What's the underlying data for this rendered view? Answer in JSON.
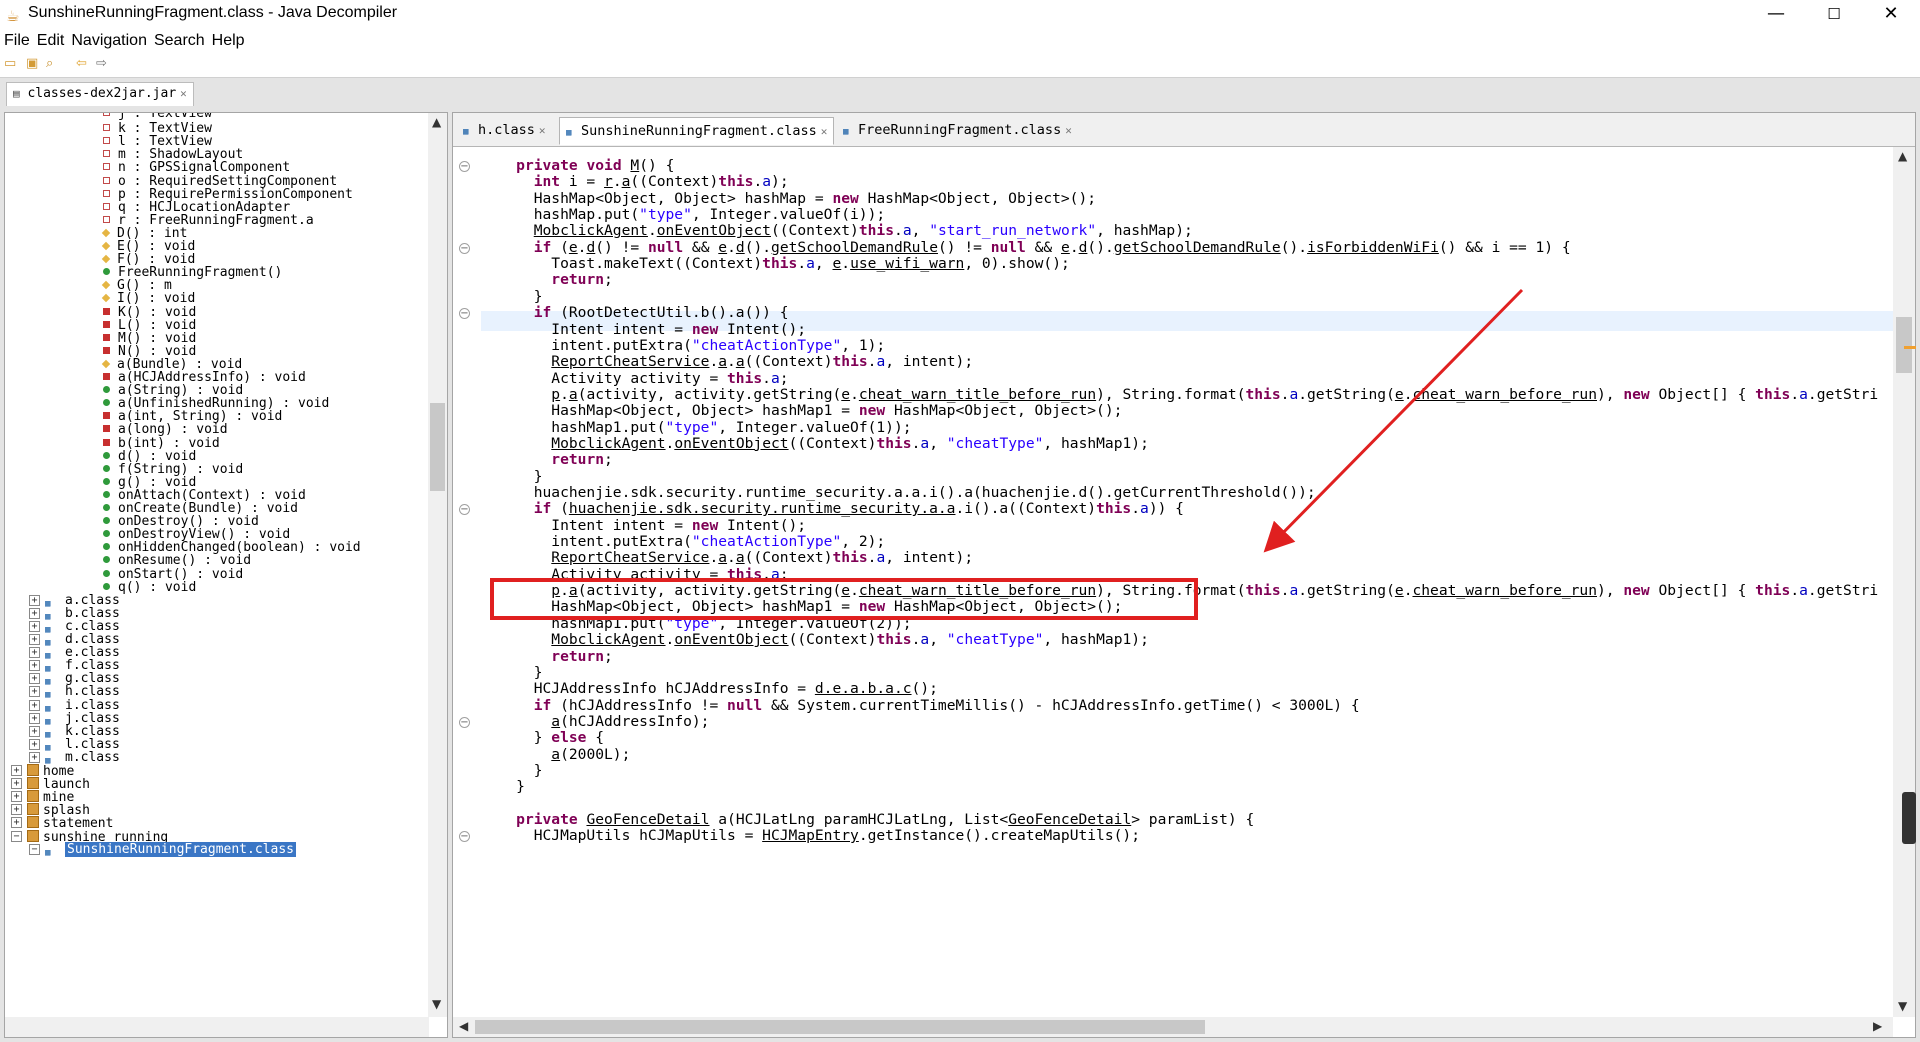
{
  "window": {
    "title": "SunshineRunningFragment.class - Java Decompiler",
    "minimize": "—",
    "maximize": "☐",
    "close": "✕"
  },
  "menu": [
    "File",
    "Edit",
    "Navigation",
    "Search",
    "Help"
  ],
  "toolbar_icons": [
    "open-file-icon",
    "open-folder-icon",
    "search-icon",
    "back-arrow-icon",
    "forward-arrow-icon"
  ],
  "file_tab": {
    "label": "classes-dex2jar.jar"
  },
  "tree": [
    {
      "t": "field",
      "label": "j : TextView",
      "indent": 98,
      "partial": true
    },
    {
      "t": "field",
      "label": "k : TextView",
      "indent": 98
    },
    {
      "t": "field",
      "label": "l : TextView",
      "indent": 98
    },
    {
      "t": "field",
      "label": "m : ShadowLayout",
      "indent": 98
    },
    {
      "t": "field",
      "label": "n : GPSSignalComponent",
      "indent": 98
    },
    {
      "t": "field",
      "label": "o : RequiredSettingComponent",
      "indent": 98
    },
    {
      "t": "field",
      "label": "p : RequirePermissionComponent",
      "indent": 98
    },
    {
      "t": "field",
      "label": "q : HCJLocationAdapter",
      "indent": 98
    },
    {
      "t": "field",
      "label": "r : FreeRunningFragment.a",
      "indent": 98
    },
    {
      "t": "protected",
      "label": "D() : int",
      "indent": 98
    },
    {
      "t": "protected",
      "label": "E() : void",
      "indent": 98
    },
    {
      "t": "protected",
      "label": "F() : void",
      "indent": 98
    },
    {
      "t": "public",
      "label": "FreeRunningFragment()",
      "indent": 98
    },
    {
      "t": "protected",
      "label": "G() : m",
      "indent": 98
    },
    {
      "t": "protected",
      "label": "I() : void",
      "indent": 98
    },
    {
      "t": "private",
      "label": "K() : void",
      "indent": 98
    },
    {
      "t": "private",
      "label": "L() : void",
      "indent": 98
    },
    {
      "t": "private",
      "label": "M() : void",
      "indent": 98
    },
    {
      "t": "private",
      "label": "N() : void",
      "indent": 98
    },
    {
      "t": "protected",
      "label": "a(Bundle) : void",
      "indent": 98
    },
    {
      "t": "private",
      "label": "a(HCJAddressInfo) : void",
      "indent": 98
    },
    {
      "t": "public",
      "label": "a(String) : void",
      "indent": 98
    },
    {
      "t": "public",
      "label": "a(UnfinishedRunning) : void",
      "indent": 98
    },
    {
      "t": "private",
      "label": "a(int, String) : void",
      "indent": 98
    },
    {
      "t": "private",
      "label": "a(long) : void",
      "indent": 98
    },
    {
      "t": "private",
      "label": "b(int) : void",
      "indent": 98
    },
    {
      "t": "public",
      "label": "d() : void",
      "indent": 98
    },
    {
      "t": "public",
      "label": "f(String) : void",
      "indent": 98
    },
    {
      "t": "public",
      "label": "g() : void",
      "indent": 98
    },
    {
      "t": "public",
      "label": "onAttach(Context) : void",
      "indent": 98
    },
    {
      "t": "public",
      "label": "onCreate(Bundle) : void",
      "indent": 98
    },
    {
      "t": "public",
      "label": "onDestroy() : void",
      "indent": 98
    },
    {
      "t": "public",
      "label": "onDestroyView() : void",
      "indent": 98
    },
    {
      "t": "public",
      "label": "onHiddenChanged(boolean) : void",
      "indent": 98
    },
    {
      "t": "public",
      "label": "onResume() : void",
      "indent": 98
    },
    {
      "t": "public",
      "label": "onStart() : void",
      "indent": 98
    },
    {
      "t": "public",
      "label": "q() : void",
      "indent": 98
    },
    {
      "t": "class",
      "label": "a.class",
      "indent": 40
    },
    {
      "t": "class",
      "label": "b.class",
      "indent": 40
    },
    {
      "t": "class",
      "label": "c.class",
      "indent": 40
    },
    {
      "t": "class",
      "label": "d.class",
      "indent": 40
    },
    {
      "t": "class",
      "label": "e.class",
      "indent": 40
    },
    {
      "t": "class",
      "label": "f.class",
      "indent": 40
    },
    {
      "t": "class",
      "label": "g.class",
      "indent": 40
    },
    {
      "t": "class",
      "label": "h.class",
      "indent": 40
    },
    {
      "t": "class",
      "label": "i.class",
      "indent": 40
    },
    {
      "t": "class",
      "label": "j.class",
      "indent": 40
    },
    {
      "t": "class",
      "label": "k.class",
      "indent": 40
    },
    {
      "t": "class",
      "label": "l.class",
      "indent": 40
    },
    {
      "t": "class",
      "label": "m.class",
      "indent": 40
    },
    {
      "t": "package",
      "label": "home",
      "indent": 22
    },
    {
      "t": "package",
      "label": "launch",
      "indent": 22
    },
    {
      "t": "package",
      "label": "mine",
      "indent": 22
    },
    {
      "t": "package",
      "label": "splash",
      "indent": 22
    },
    {
      "t": "package",
      "label": "statement",
      "indent": 22
    },
    {
      "t": "package-open",
      "label": "sunshine_running",
      "indent": 22
    },
    {
      "t": "class-selected",
      "label": "SunshineRunningFragment.class",
      "indent": 40
    }
  ],
  "editor_tabs": [
    {
      "label": "h.class",
      "active": false
    },
    {
      "label": "SunshineRunningFragment.class",
      "active": true
    },
    {
      "label": "FreeRunningFragment.class",
      "active": false
    }
  ],
  "code": [
    [
      [
        "    "
      ],
      [
        "private",
        "kw"
      ],
      [
        " "
      ],
      [
        "void",
        "kw"
      ],
      [
        " "
      ],
      [
        "M",
        "ul"
      ],
      [
        "() {"
      ]
    ],
    [
      [
        "      "
      ],
      [
        "int",
        "kw"
      ],
      [
        " i = "
      ],
      [
        "r",
        "ul"
      ],
      [
        "."
      ],
      [
        "a",
        "ul"
      ],
      [
        "((Context)"
      ],
      [
        "this",
        "kw"
      ],
      [
        "."
      ],
      [
        "a",
        "fld"
      ],
      [
        ");"
      ]
    ],
    [
      [
        "      HashMap<Object, Object> hashMap = "
      ],
      [
        "new",
        "kw"
      ],
      [
        " HashMap<Object, Object>();"
      ]
    ],
    [
      [
        "      hashMap.put("
      ],
      [
        "\"type\"",
        "str"
      ],
      [
        ", Integer.valueOf(i));"
      ]
    ],
    [
      [
        "      "
      ],
      [
        "MobclickAgent",
        "ul"
      ],
      [
        "."
      ],
      [
        "onEventObject",
        "ul"
      ],
      [
        "((Context)"
      ],
      [
        "this",
        "kw"
      ],
      [
        "."
      ],
      [
        "a",
        "fld"
      ],
      [
        ", "
      ],
      [
        "\"start_run_network\"",
        "str"
      ],
      [
        ", hashMap);"
      ]
    ],
    [
      [
        "      "
      ],
      [
        "if",
        "kw"
      ],
      [
        " ("
      ],
      [
        "e",
        "ul"
      ],
      [
        "."
      ],
      [
        "d",
        "ul"
      ],
      [
        "() != "
      ],
      [
        "null",
        "kw"
      ],
      [
        " && "
      ],
      [
        "e",
        "ul"
      ],
      [
        "."
      ],
      [
        "d",
        "ul"
      ],
      [
        "()."
      ],
      [
        "getSchoolDemandRule",
        "ul"
      ],
      [
        "() != "
      ],
      [
        "null",
        "kw"
      ],
      [
        " && "
      ],
      [
        "e",
        "ul"
      ],
      [
        "."
      ],
      [
        "d",
        "ul"
      ],
      [
        "()."
      ],
      [
        "getSchoolDemandRule",
        "ul"
      ],
      [
        "()."
      ],
      [
        "isForbiddenWiFi",
        "ul"
      ],
      [
        "() && i == 1) {"
      ]
    ],
    [
      [
        "        Toast.makeText((Context)"
      ],
      [
        "this",
        "kw"
      ],
      [
        "."
      ],
      [
        "a",
        "fld"
      ],
      [
        ", "
      ],
      [
        "e",
        "ul"
      ],
      [
        "."
      ],
      [
        "use_wifi_warn",
        "ul"
      ],
      [
        ", 0).show();"
      ]
    ],
    [
      [
        "        "
      ],
      [
        "return",
        "kw"
      ],
      [
        ";"
      ]
    ],
    [
      [
        "      }"
      ]
    ],
    [
      [
        "      "
      ],
      [
        "if",
        "kw"
      ],
      [
        " (RootDetectUtil.b().a()) {"
      ]
    ],
    [
      [
        "        Intent intent = "
      ],
      [
        "new",
        "kw"
      ],
      [
        " Intent();"
      ]
    ],
    [
      [
        "        intent.putExtra("
      ],
      [
        "\"cheatActionType\"",
        "str"
      ],
      [
        ", 1);"
      ]
    ],
    [
      [
        "        "
      ],
      [
        "ReportCheatService",
        "ul"
      ],
      [
        "."
      ],
      [
        "a",
        "ul"
      ],
      [
        "."
      ],
      [
        "a",
        "ul"
      ],
      [
        "((Context)"
      ],
      [
        "this",
        "kw"
      ],
      [
        "."
      ],
      [
        "a",
        "fld"
      ],
      [
        ", intent);"
      ]
    ],
    [
      [
        "        Activity activity = "
      ],
      [
        "this",
        "kw"
      ],
      [
        "."
      ],
      [
        "a",
        "fld"
      ],
      [
        ";"
      ]
    ],
    [
      [
        "        "
      ],
      [
        "p",
        "ul"
      ],
      [
        "."
      ],
      [
        "a",
        "ul"
      ],
      [
        "(activity, activity.getString("
      ],
      [
        "e",
        "ul"
      ],
      [
        "."
      ],
      [
        "cheat_warn_title_before_run",
        "ul"
      ],
      [
        "), String.format("
      ],
      [
        "this",
        "kw"
      ],
      [
        "."
      ],
      [
        "a",
        "fld"
      ],
      [
        ".getString("
      ],
      [
        "e",
        "ul"
      ],
      [
        "."
      ],
      [
        "cheat_warn_before_run",
        "ul"
      ],
      [
        "), "
      ],
      [
        "new",
        "kw"
      ],
      [
        " Object[] { "
      ],
      [
        "this",
        "kw"
      ],
      [
        "."
      ],
      [
        "a",
        "fld"
      ],
      [
        ".getStri"
      ]
    ],
    [
      [
        "        HashMap<Object, Object> hashMap1 = "
      ],
      [
        "new",
        "kw"
      ],
      [
        " HashMap<Object, Object>();"
      ]
    ],
    [
      [
        "        hashMap1.put("
      ],
      [
        "\"type\"",
        "str"
      ],
      [
        ", Integer.valueOf(1));"
      ]
    ],
    [
      [
        "        "
      ],
      [
        "MobclickAgent",
        "ul"
      ],
      [
        "."
      ],
      [
        "onEventObject",
        "ul"
      ],
      [
        "((Context)"
      ],
      [
        "this",
        "kw"
      ],
      [
        "."
      ],
      [
        "a",
        "fld"
      ],
      [
        ", "
      ],
      [
        "\"cheatType\"",
        "str"
      ],
      [
        ", hashMap1);"
      ]
    ],
    [
      [
        "        "
      ],
      [
        "return",
        "kw"
      ],
      [
        ";"
      ]
    ],
    [
      [
        "      }"
      ]
    ],
    [
      [
        "      huachenjie.sdk.security.runtime_security.a.a.i().a(huachenjie.d().getCurrentThreshold());"
      ]
    ],
    [
      [
        "      "
      ],
      [
        "if",
        "kw"
      ],
      [
        " ("
      ],
      [
        "huachenjie.sdk.security.runtime_security.a.a",
        "ul"
      ],
      [
        ".i().a((Context)"
      ],
      [
        "this",
        "kw"
      ],
      [
        "."
      ],
      [
        "a",
        "fld"
      ],
      [
        ")) {"
      ]
    ],
    [
      [
        "        Intent intent = "
      ],
      [
        "new",
        "kw"
      ],
      [
        " Intent();"
      ]
    ],
    [
      [
        "        intent.putExtra("
      ],
      [
        "\"cheatActionType\"",
        "str"
      ],
      [
        ", 2);"
      ]
    ],
    [
      [
        "        "
      ],
      [
        "ReportCheatService",
        "ul"
      ],
      [
        "."
      ],
      [
        "a",
        "ul"
      ],
      [
        "."
      ],
      [
        "a",
        "ul"
      ],
      [
        "((Context)"
      ],
      [
        "this",
        "kw"
      ],
      [
        "."
      ],
      [
        "a",
        "fld"
      ],
      [
        ", intent);"
      ]
    ],
    [
      [
        "        Activity activity = "
      ],
      [
        "this",
        "kw"
      ],
      [
        "."
      ],
      [
        "a",
        "fld"
      ],
      [
        ";"
      ]
    ],
    [
      [
        "        "
      ],
      [
        "p",
        "ul"
      ],
      [
        "."
      ],
      [
        "a",
        "ul"
      ],
      [
        "(activity, activity.getString("
      ],
      [
        "e",
        "ul"
      ],
      [
        "."
      ],
      [
        "cheat_warn_title_before_run",
        "ul"
      ],
      [
        "), String.format("
      ],
      [
        "this",
        "kw"
      ],
      [
        "."
      ],
      [
        "a",
        "fld"
      ],
      [
        ".getString("
      ],
      [
        "e",
        "ul"
      ],
      [
        "."
      ],
      [
        "cheat_warn_before_run",
        "ul"
      ],
      [
        "), "
      ],
      [
        "new",
        "kw"
      ],
      [
        " Object[] { "
      ],
      [
        "this",
        "kw"
      ],
      [
        "."
      ],
      [
        "a",
        "fld"
      ],
      [
        ".getStri"
      ]
    ],
    [
      [
        "        HashMap<Object, Object> hashMap1 = "
      ],
      [
        "new",
        "kw"
      ],
      [
        " HashMap<Object, Object>();"
      ]
    ],
    [
      [
        "        hashMap1.put("
      ],
      [
        "\"type\"",
        "str"
      ],
      [
        ", Integer.valueOf(2));"
      ]
    ],
    [
      [
        "        "
      ],
      [
        "MobclickAgent",
        "ul"
      ],
      [
        "."
      ],
      [
        "onEventObject",
        "ul"
      ],
      [
        "((Context)"
      ],
      [
        "this",
        "kw"
      ],
      [
        "."
      ],
      [
        "a",
        "fld"
      ],
      [
        ", "
      ],
      [
        "\"cheatType\"",
        "str"
      ],
      [
        ", hashMap1);"
      ]
    ],
    [
      [
        "        "
      ],
      [
        "return",
        "kw"
      ],
      [
        ";"
      ]
    ],
    [
      [
        "      }"
      ]
    ],
    [
      [
        "      HCJAddressInfo hCJAddressInfo = "
      ],
      [
        "d.e.a.b.a.c",
        "ul"
      ],
      [
        "();"
      ]
    ],
    [
      [
        "      "
      ],
      [
        "if",
        "kw"
      ],
      [
        " (hCJAddressInfo != "
      ],
      [
        "null",
        "kw"
      ],
      [
        " && System.currentTimeMillis() - hCJAddressInfo.getTime() < 3000L) {"
      ]
    ],
    [
      [
        "        "
      ],
      [
        "a",
        "ul"
      ],
      [
        "(hCJAddressInfo);"
      ]
    ],
    [
      [
        "      } "
      ],
      [
        "else",
        "kw"
      ],
      [
        " {"
      ]
    ],
    [
      [
        "        "
      ],
      [
        "a",
        "ul"
      ],
      [
        "(2000L);"
      ]
    ],
    [
      [
        "      }"
      ]
    ],
    [
      [
        "    }"
      ]
    ],
    [
      [
        ""
      ]
    ],
    [
      [
        "    "
      ],
      [
        "private",
        "kw"
      ],
      [
        " "
      ],
      [
        "GeoFenceDetail",
        "ul"
      ],
      [
        " a(HCJLatLng paramHCJLatLng, List<"
      ],
      [
        "GeoFenceDetail",
        "ul"
      ],
      [
        "> paramList) {"
      ]
    ],
    [
      [
        "      HCJMapUtils hCJMapUtils = "
      ],
      [
        "HCJMapEntry",
        "ul"
      ],
      [
        ".getInstance().createMapUtils();"
      ]
    ]
  ],
  "fold_lines": [
    0,
    5,
    9,
    21,
    34,
    41
  ]
}
